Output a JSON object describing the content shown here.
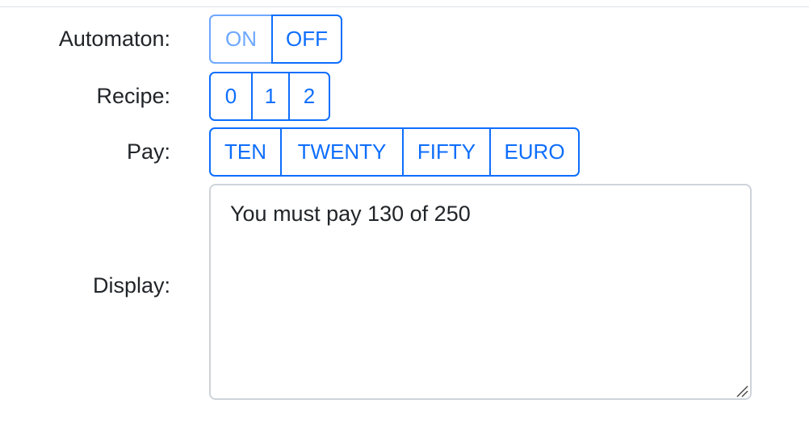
{
  "automaton": {
    "label": "Automaton:",
    "buttons": [
      {
        "label": "ON",
        "state": "disabled"
      },
      {
        "label": "OFF",
        "state": "enabled"
      }
    ]
  },
  "recipe": {
    "label": "Recipe:",
    "buttons": [
      {
        "label": "0"
      },
      {
        "label": "1"
      },
      {
        "label": "2"
      }
    ]
  },
  "pay": {
    "label": "Pay:",
    "buttons": [
      {
        "label": "TEN"
      },
      {
        "label": "TWENTY"
      },
      {
        "label": "FIFTY"
      },
      {
        "label": "EURO"
      }
    ]
  },
  "display": {
    "label": "Display:",
    "value": "You must pay 130 of 250"
  },
  "colors": {
    "primary": "#0d6efd",
    "primary_disabled": "#6ea8fe",
    "text": "#212529",
    "border": "#ced4da"
  },
  "icons": {
    "resize_grip": "resize-grip-icon"
  }
}
